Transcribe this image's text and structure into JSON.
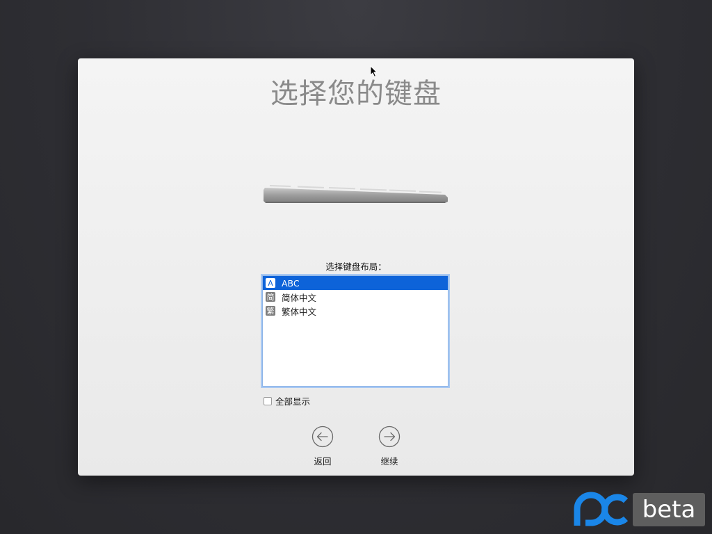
{
  "dialog": {
    "title": "选择您的键盘",
    "prompt": "选择键盘布局：",
    "layouts": [
      {
        "badge": "A",
        "label": "ABC",
        "selected": true
      },
      {
        "badge": "简",
        "label": "简体中文",
        "selected": false
      },
      {
        "badge": "繁",
        "label": "繁体中文",
        "selected": false
      }
    ],
    "show_all_label": "全部显示",
    "show_all_checked": false,
    "back_label": "返回",
    "continue_label": "继续"
  },
  "icons": {
    "back": "back-arrow-icon",
    "continue": "forward-arrow-icon",
    "keyboard": "keyboard-illustration"
  },
  "watermark": {
    "text": "beta"
  },
  "colors": {
    "selection": "#0d63d9",
    "logo_blue": "#1a86e8",
    "panel_bg": "#f0f0f0",
    "desktop_bg": "#2e2e33"
  }
}
